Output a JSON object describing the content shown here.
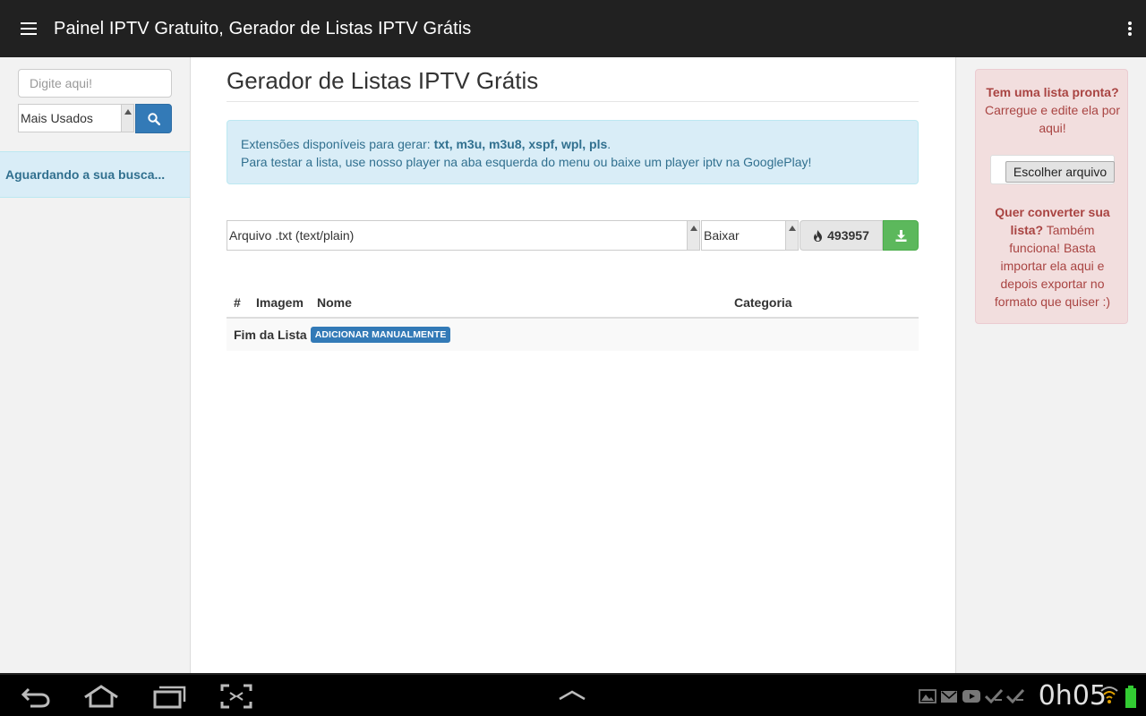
{
  "appbar": {
    "title": "Painel IPTV Gratuito, Gerador de Listas IPTV Grátis"
  },
  "sidebar": {
    "search_placeholder": "Digite aqui!",
    "filter_selected": "Mais Usados",
    "status_text": "Aguardando a sua busca..."
  },
  "main": {
    "title": "Gerador de Listas IPTV Grátis",
    "alert": {
      "line1_prefix": "Extensões disponíveis para gerar: ",
      "line1_exts": "txt, m3u, m3u8, xspf, wpl, pls",
      "line1_suffix": ".",
      "line2": "Para testar a lista, use nosso player na aba esquerda do menu ou baixe um player iptv na GooglePlay!"
    },
    "format_selected": "Arquivo .txt (text/plain)",
    "action_selected": "Baixar",
    "counter": "493957",
    "table": {
      "headers": {
        "num": "#",
        "image": "Imagem",
        "name": "Nome",
        "category": "Categoria"
      },
      "end_label": "Fim da Lista",
      "add_badge": "ADICIONAR MANUALMENTE"
    }
  },
  "rightpanel": {
    "q1_bold": "Tem uma lista pronta?",
    "q1_rest": " Carregue e edite ela por aqui!",
    "file_button": "Escolher arquivo",
    "q2_bold": "Quer converter sua lista?",
    "q2_rest": " Também funciona! Basta importar ela aqui e depois exportar no formato que quiser :)"
  },
  "systembar": {
    "clock": "0h05"
  },
  "colors": {
    "appbar_bg": "#212121",
    "primary": "#337ab7",
    "success": "#5cb85c",
    "info_bg": "#d9edf7",
    "info_text": "#31708f",
    "danger_bg": "#f2dede",
    "danger_text": "#a94442",
    "battery": "#33cc33"
  },
  "icons": [
    "menu-icon",
    "overflow-menu-icon",
    "search-icon",
    "fire-icon",
    "download-icon",
    "back-icon",
    "home-icon",
    "recent-apps-icon",
    "screenshot-icon",
    "chevron-up-icon",
    "gallery-icon",
    "email-icon",
    "youtube-icon",
    "download-complete-icon",
    "wifi-icon",
    "battery-icon"
  ]
}
